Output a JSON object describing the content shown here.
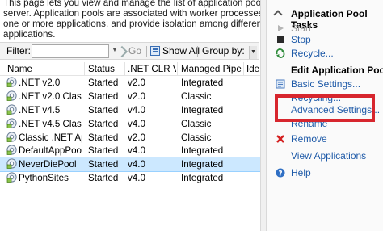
{
  "intro_lines": [
    "This page lets you view and manage the list of application pools on the",
    "server. Application pools are associated with worker processes, contain",
    "one or more applications, and provide isolation among different",
    "applications."
  ],
  "filter_bar": {
    "filter_label": "Filter:",
    "filter_value": "",
    "go_label": "Go",
    "show_all_label": "Show All",
    "group_by_label": "Group by:"
  },
  "grid": {
    "columns": [
      "Name",
      "Status",
      ".NET CLR V...",
      "Managed Pipel...",
      "Ide"
    ],
    "rows": [
      {
        "name": ".NET v2.0",
        "status": "Started",
        "clr": "v2.0",
        "pipeline": "Integrated",
        "identity": "",
        "selected": false
      },
      {
        "name": ".NET v2.0 Classic",
        "status": "Started",
        "clr": "v2.0",
        "pipeline": "Classic",
        "identity": "",
        "selected": false
      },
      {
        "name": ".NET v4.5",
        "status": "Started",
        "clr": "v4.0",
        "pipeline": "Integrated",
        "identity": "",
        "selected": false
      },
      {
        "name": ".NET v4.5 Classic",
        "status": "Started",
        "clr": "v4.0",
        "pipeline": "Classic",
        "identity": "",
        "selected": false
      },
      {
        "name": "Classic .NET Ap...",
        "status": "Started",
        "clr": "v2.0",
        "pipeline": "Classic",
        "identity": "",
        "selected": false
      },
      {
        "name": "DefaultAppPool",
        "status": "Started",
        "clr": "v4.0",
        "pipeline": "Integrated",
        "identity": "",
        "selected": false
      },
      {
        "name": "NeverDiePool",
        "status": "Started",
        "clr": "v4.0",
        "pipeline": "Integrated",
        "identity": "",
        "selected": true
      },
      {
        "name": "PythonSites",
        "status": "Started",
        "clr": "v4.0",
        "pipeline": "Integrated",
        "identity": "",
        "selected": false
      }
    ]
  },
  "actions": {
    "header_title": "Application Pool Tasks",
    "items": [
      {
        "label": "Start",
        "kind": "disabled",
        "icon": "start-icon"
      },
      {
        "label": "Stop",
        "kind": "link",
        "icon": "stop-icon"
      },
      {
        "label": "Recycle...",
        "kind": "link",
        "icon": "recycle-icon"
      },
      {
        "label": "Edit Application Pool",
        "kind": "heading",
        "icon": ""
      },
      {
        "label": "Basic Settings...",
        "kind": "link",
        "icon": "settings-icon"
      },
      {
        "label": "Recycling...",
        "kind": "link",
        "icon": ""
      },
      {
        "label": "Advanced Settings...",
        "kind": "link",
        "icon": ""
      },
      {
        "label": "Rename",
        "kind": "link",
        "icon": ""
      },
      {
        "label": "Remove",
        "kind": "link",
        "icon": "remove-icon"
      },
      {
        "label": "View Applications",
        "kind": "link",
        "icon": ""
      },
      {
        "label": "Help",
        "kind": "link",
        "icon": "help-icon"
      }
    ]
  },
  "colors": {
    "highlight_box": "#d7262e",
    "link": "#1e5aa8",
    "selected_row": "#cce8ff"
  }
}
